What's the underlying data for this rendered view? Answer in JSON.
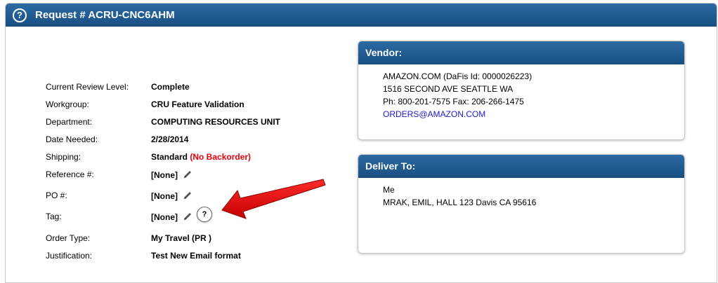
{
  "header": {
    "title": "Request # ACRU-CNC6AHM",
    "help_icon_glyph": "?"
  },
  "details": [
    {
      "label": "Current Review Level:",
      "value": "Complete"
    },
    {
      "label": "Workgroup:",
      "value": "CRU Feature Validation"
    },
    {
      "label": "Department:",
      "value": "COMPUTING RESOURCES UNIT"
    },
    {
      "label": "Date Needed:",
      "value": "2/28/2014"
    },
    {
      "label": "Shipping:",
      "value": "Standard",
      "extra": "(No Backorder)"
    },
    {
      "label": "Reference #:",
      "value": "[None]"
    },
    {
      "label": "PO #:",
      "value": "[None]"
    },
    {
      "label": "Tag:",
      "value": "[None]",
      "help_glyph": "?"
    },
    {
      "label": "Order Type:",
      "value": "My Travel (PR )"
    },
    {
      "label": "Justification:",
      "value": "Test New Email format"
    }
  ],
  "vendor": {
    "title": "Vendor:",
    "lines": [
      "AMAZON.COM (DaFis Id: 0000026223)",
      "1516 SECOND AVE SEATTLE WA",
      "Ph: 800-201-7575 Fax: 206-266-1475"
    ],
    "email": "ORDERS@AMAZON.COM"
  },
  "deliver_to": {
    "title": "Deliver To:",
    "lines": [
      "Me",
      "MRAK, EMIL, HALL 123 Davis CA 95616"
    ]
  },
  "colors": {
    "header_blue": "#184f82",
    "warning_red": "#e8000b",
    "link_blue": "#1a1ad6",
    "annotation_arrow": "#e8000b"
  },
  "icons": [
    "help-icon",
    "pencil-icon",
    "annotation-arrow"
  ]
}
